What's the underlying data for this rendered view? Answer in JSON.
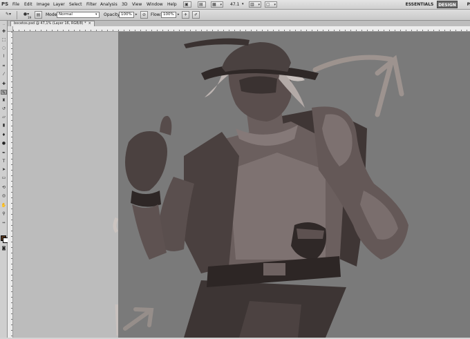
{
  "app": {
    "logo": "PS"
  },
  "menu": [
    "File",
    "Edit",
    "Image",
    "Layer",
    "Select",
    "Filter",
    "Analysis",
    "3D",
    "View",
    "Window",
    "Help"
  ],
  "menubar_tools": {
    "zoom": "47.1"
  },
  "workspaces": {
    "essentials": "ESSENTIALS",
    "design": "DESIGN",
    "painting": "PAI"
  },
  "options": {
    "mode_label": "Mode:",
    "mode_value": "Normal",
    "opacity_label": "Opacity:",
    "opacity_value": "100%",
    "flow_label": "Flow:",
    "flow_value": "100%",
    "brush_size": "19"
  },
  "document": {
    "tab_title": "bocetos.psd @ 47,1% (Layer 16, RGB/8) *",
    "close_glyph": "×"
  },
  "colors": {
    "foreground": "#5a3a22",
    "background": "#ffffff",
    "canvas": "#7a7a7a"
  },
  "tools": [
    "move-icon",
    "marquee-icon",
    "lasso-icon",
    "quick-select-icon",
    "crop-icon",
    "eyedropper-icon",
    "healing-icon",
    "brush-icon",
    "clone-stamp-icon",
    "history-brush-icon",
    "eraser-icon",
    "gradient-icon",
    "blur-icon",
    "dodge-icon",
    "pen-icon",
    "type-icon",
    "path-select-icon",
    "shape-icon",
    "3d-rotate-icon",
    "3d-orbit-icon",
    "hand-icon",
    "zoom-icon"
  ]
}
